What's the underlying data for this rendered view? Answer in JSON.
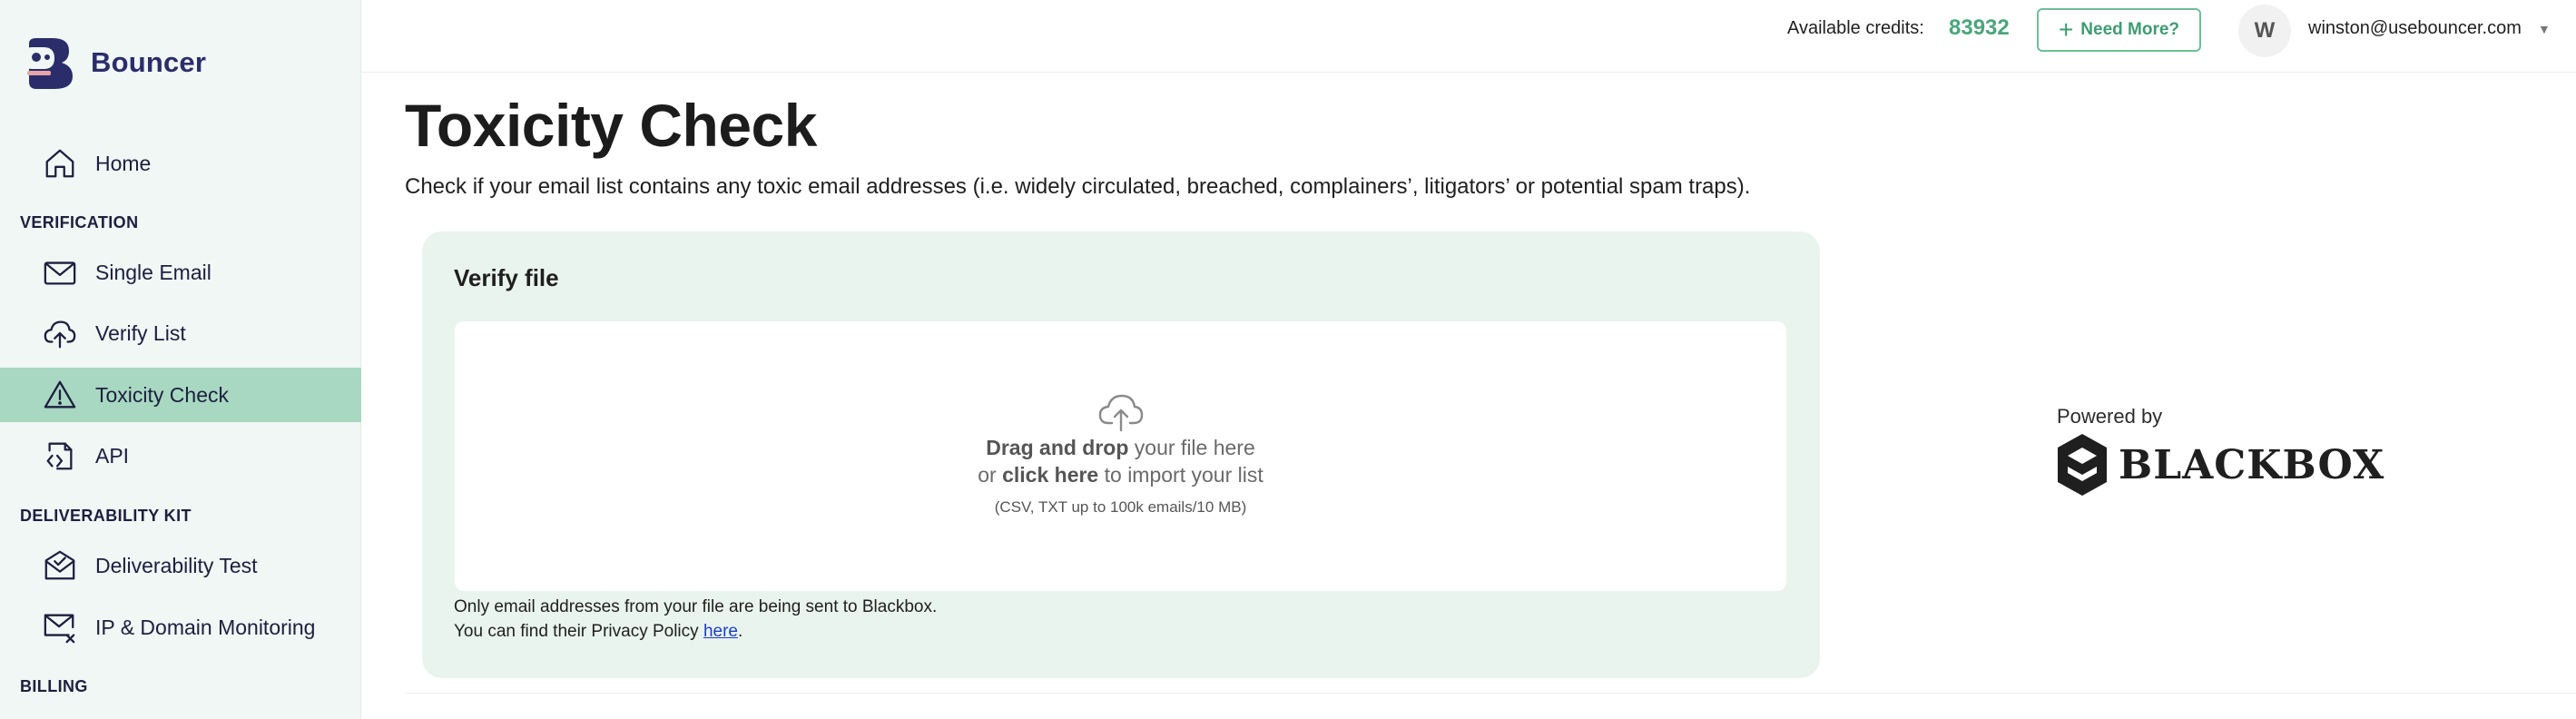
{
  "app": {
    "name": "Bouncer"
  },
  "sidebar": {
    "home": "Home",
    "sections": [
      {
        "title": "VERIFICATION",
        "items": [
          "Single Email",
          "Verify List",
          "Toxicity Check",
          "API"
        ]
      },
      {
        "title": "DELIVERABILITY KIT",
        "items": [
          "Deliverability Test",
          "IP & Domain Monitoring"
        ]
      },
      {
        "title": "BILLING",
        "items": []
      }
    ],
    "active_item": "Toxicity Check"
  },
  "topbar": {
    "credits_label": "Available credits:",
    "credits_value": "83932",
    "need_more_label": "Need More?",
    "avatar_initial": "W",
    "user_email": "winston@usebouncer.com"
  },
  "main": {
    "title": "Toxicity Check",
    "description": "Check if your email list contains any toxic email addresses (i.e. widely circulated, breached, complainers’, litigators’ or potential spam traps).",
    "card": {
      "title": "Verify file",
      "drop_bold": "Drag and drop",
      "drop_rest": " your file here",
      "click_prefix": "or ",
      "click_bold": "click here",
      "click_rest": " to import your list",
      "note": "(CSV, TXT up to 100k emails/10 MB)",
      "footer_line1": "Only email addresses from your file are being sent to Blackbox.",
      "footer_line2_prefix": "You can find their Privacy Policy ",
      "footer_link": "here",
      "footer_line2_suffix": "."
    },
    "powered_by": "Powered by",
    "partner": "BLACKBOX"
  },
  "colors": {
    "accent": "#4aa67c",
    "active_nav": "#a8d8c1",
    "sidebar_bg": "#f0f7f4",
    "card_bg": "#eaf4ef",
    "brand": "#2b2d6b"
  }
}
